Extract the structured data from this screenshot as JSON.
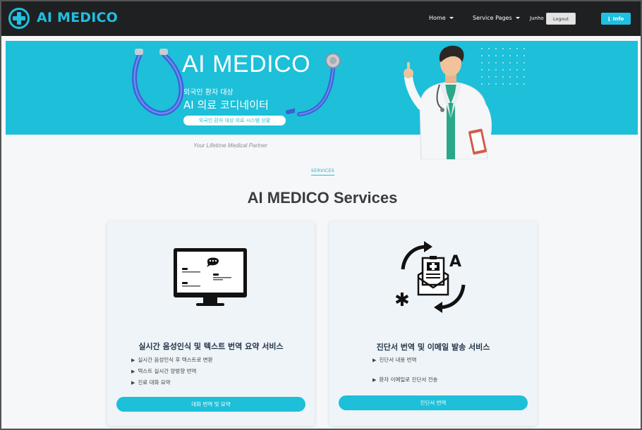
{
  "navbar": {
    "brand": "AI MEDICO",
    "home": "Home",
    "service_pages": "Service Pages",
    "user": "Junho",
    "logout": "Logout",
    "info": "Info"
  },
  "hero": {
    "title": "AI MEDICO",
    "sub1": "외국인 환자 대상",
    "sub2": "AI 의료 코디네이터",
    "pill": "외국인 환자 대상 의료 시스템 상황"
  },
  "tagline": "Your Lifetime Medical Partner",
  "services": {
    "label": "SERVICES",
    "title": "AI MEDICO Services"
  },
  "cards": [
    {
      "title": "실시간 음성인식 및 텍스트 번역 요약 서비스",
      "features": [
        "실시간 음성인식 후 텍스트로 변환",
        "텍스트 실시간 양방향 번역",
        "진료 대화 요약"
      ],
      "button": "대화 번역 및 요약"
    },
    {
      "title": "진단서 번역 및 이메일 발송 서비스",
      "features": [
        "진단서 내용 번역",
        "환자 이메일로 진단서 전송"
      ],
      "button": "진단서 번역"
    }
  ],
  "colors": {
    "accent": "#1dbfd9",
    "navbar": "#1f2022"
  }
}
